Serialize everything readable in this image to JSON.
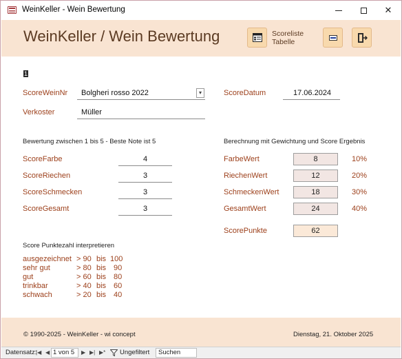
{
  "window": {
    "title": "WeinKeller - Wein Bewertung",
    "minimize_glyph": "",
    "close_glyph": "✕"
  },
  "header": {
    "form_title": "WeinKeller / Wein Bewertung",
    "scoreliste_label_line1": "Scoreliste",
    "scoreliste_label_line2": "Tabelle",
    "buttons": [
      {
        "name": "scoreliste-tabelle-button",
        "icon": "table-list-icon"
      },
      {
        "name": "edit-button",
        "icon": "form-edit-icon"
      },
      {
        "name": "exit-button",
        "icon": "exit-door-icon"
      }
    ],
    "accent_color": "#f8d9ad",
    "band_color": "#f9e4d2"
  },
  "record": {
    "marker": "1",
    "score_wein_nr_label": "ScoreWeinNr",
    "score_wein_nr_value": "Bolgheri rosso 2022",
    "score_datum_label": "ScoreDatum",
    "score_datum_value": "17.06.2024",
    "verkoster_label": "Verkoster",
    "verkoster_value": "Müller"
  },
  "bewertung": {
    "heading": "Bewertung zwischen 1 bis 5 - Beste Note ist 5",
    "items": [
      {
        "label": "ScoreFarbe",
        "value": "4"
      },
      {
        "label": "ScoreRiechen",
        "value": "3"
      },
      {
        "label": "ScoreSchmecken",
        "value": "3"
      },
      {
        "label": "ScoreGesamt",
        "value": "3"
      }
    ]
  },
  "berechnung": {
    "heading": "Berechnung mit Gewichtung und Score Ergebnis",
    "items": [
      {
        "label": "FarbeWert",
        "value": "8",
        "weight": "10%"
      },
      {
        "label": "RiechenWert",
        "value": "12",
        "weight": "20%"
      },
      {
        "label": "SchmeckenWert",
        "value": "18",
        "weight": "30%"
      },
      {
        "label": "GesamtWert",
        "value": "24",
        "weight": "40%"
      }
    ],
    "punkte_label": "ScorePunkte",
    "punkte_value": "62"
  },
  "interpretation": {
    "heading": "Score Punktezahl interpretieren",
    "rows": [
      {
        "name": "ausgezeichnet",
        "from": "> 90",
        "bis": "bis",
        "to": "100"
      },
      {
        "name": "sehr gut",
        "from": "> 80",
        "bis": "bis",
        "to": "90"
      },
      {
        "name": "gut",
        "from": "> 60",
        "bis": "bis",
        "to": "80"
      },
      {
        "name": "trinkbar",
        "from": "> 40",
        "bis": "bis",
        "to": "60"
      },
      {
        "name": "schwach",
        "from": "> 20",
        "bis": "bis",
        "to": "40"
      }
    ]
  },
  "footer": {
    "copyright": "© 1990-2025 - WeinKeller - wi concept",
    "date": "Dienstag, 21. Oktober 2025"
  },
  "navbar": {
    "label": "Datensatz:",
    "position": "1 von 5",
    "filter_label": "Ungefiltert",
    "search_label": "Suchen"
  }
}
